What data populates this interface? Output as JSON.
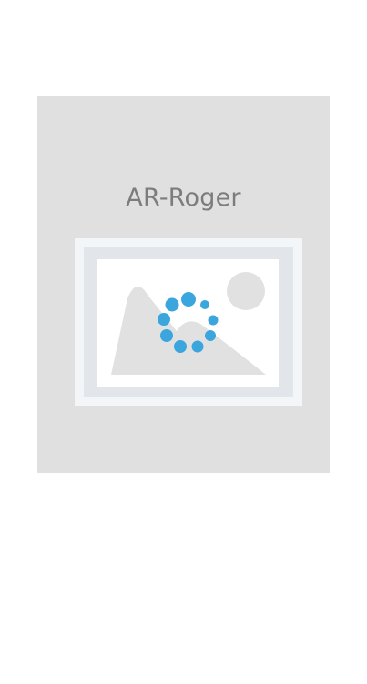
{
  "app": {
    "card_title": "AR-Roger"
  },
  "placeholder": {
    "icon": "image-placeholder-icon",
    "spinner": "loading-spinner-icon"
  },
  "colors": {
    "card_bg": "#e0e0e0",
    "frame": "#f3f6f9",
    "mountain": "#e1e1e1",
    "spinner": "#3aa6dd",
    "title_text": "#7c7c7c"
  }
}
